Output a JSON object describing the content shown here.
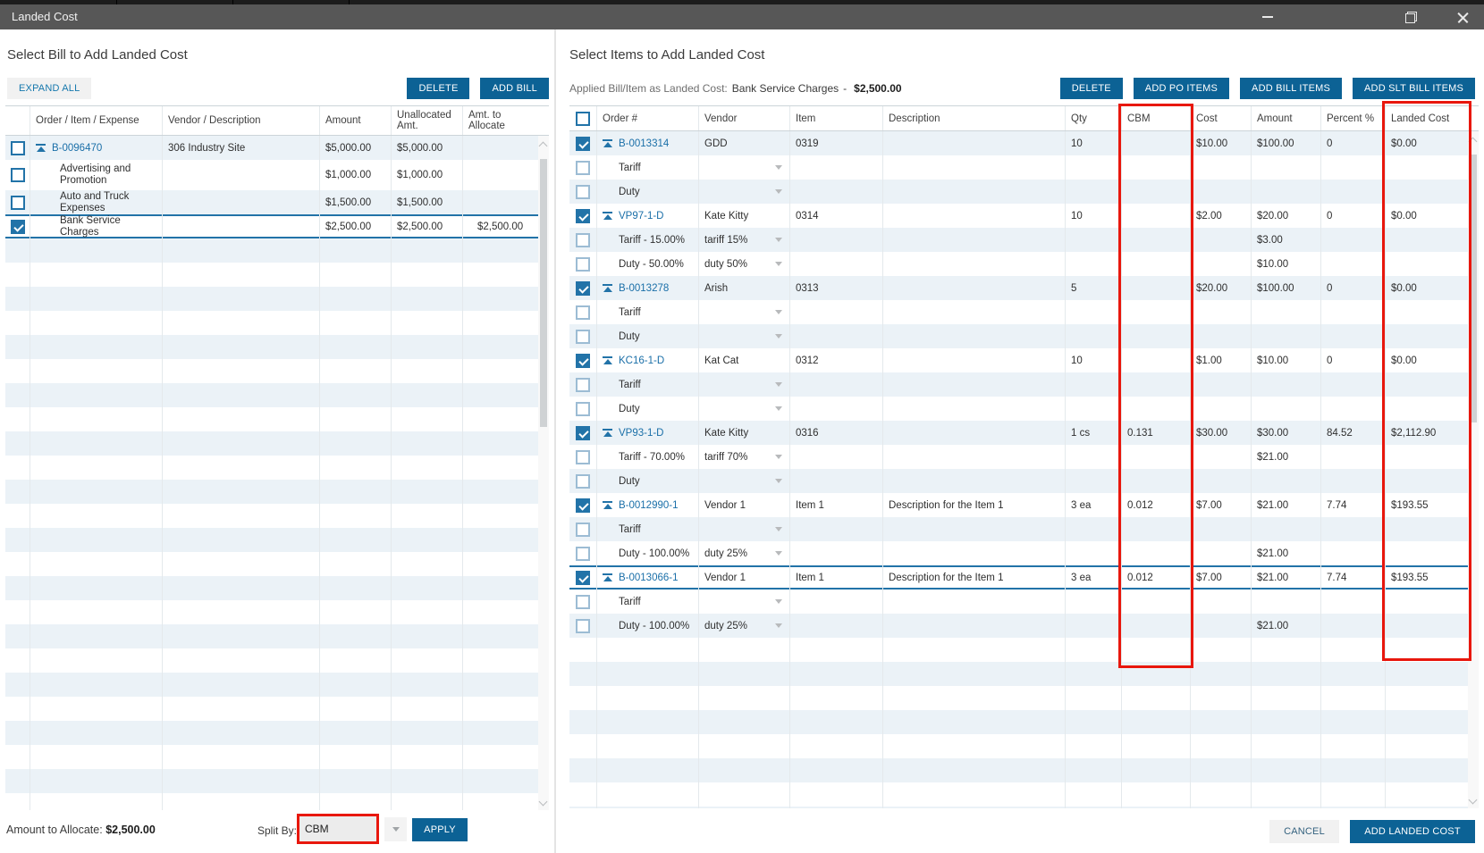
{
  "window": {
    "title": "Landed Cost"
  },
  "annotation_color": "#e8170d",
  "icons": {
    "collapse_icon": "bar-over-up-triangle",
    "dropdown_icon": "down-triangle",
    "checkbox_checked": "white-check-on-blue",
    "minimize_icon": "dash",
    "restore_icon": "overlapping-squares",
    "close_icon": "x"
  },
  "left_panel": {
    "heading": "Select Bill to Add Landed Cost",
    "expand_all_label": "EXPAND ALL",
    "delete_label": "DELETE",
    "add_bill_label": "ADD BILL",
    "table": {
      "columns": [
        "",
        "Order / Item / Expense",
        "Vendor / Description",
        "Amount",
        "Unallocated Amt.",
        "Amt. to Allocate"
      ],
      "rows": [
        {
          "checked": false,
          "link": "B-0096470",
          "vendor": "306 Industry Site",
          "amount": "$5,000.00",
          "unallocated": "$5,000.00",
          "allocate": "",
          "shade": true
        },
        {
          "checked": false,
          "label": "Advertising and Promotion",
          "vendor": "",
          "amount": "$1,000.00",
          "unallocated": "$1,000.00",
          "allocate": "",
          "shade": false,
          "tall": true
        },
        {
          "checked": false,
          "label": "Auto and Truck Expenses",
          "vendor": "",
          "amount": "$1,500.00",
          "unallocated": "$1,500.00",
          "allocate": "",
          "shade": true
        },
        {
          "checked": true,
          "label": "Bank Service Charges",
          "vendor": "",
          "amount": "$2,500.00",
          "unallocated": "$2,500.00",
          "allocate": "$2,500.00",
          "shade": false,
          "selected": true
        }
      ],
      "empty_rows": 24
    },
    "footer": {
      "amount_to_allocate_label": "Amount to Allocate:",
      "amount_to_allocate_value": "$2,500.00",
      "split_by_label": "Split By:",
      "split_by_value": "CBM",
      "apply_label": "APPLY"
    }
  },
  "right_panel": {
    "heading": "Select Items to Add Landed Cost",
    "applied_label": "Applied Bill/Item as Landed Cost:",
    "applied_bill": "Bank Service Charges",
    "applied_separator": "-",
    "applied_amount": "$2,500.00",
    "delete_label": "DELETE",
    "add_po_items_label": "ADD PO ITEMS",
    "add_bill_items_label": "ADD BILL ITEMS",
    "add_slt_bill_items_label": "ADD SLT BILL ITEMS",
    "table": {
      "columns": [
        "",
        "Order #",
        "Vendor",
        "Item",
        "Description",
        "Qty",
        "CBM",
        "Cost",
        "Amount",
        "Percent %",
        "Landed Cost"
      ],
      "rows": [
        {
          "type": "parent",
          "checked": true,
          "order": "B-0013314",
          "vendor": "GDD",
          "item": "0319",
          "description": "",
          "qty": "10",
          "cbm": "",
          "cost": "$10.00",
          "amount": "$100.00",
          "percent": "0",
          "landed": "$0.00",
          "shade": true
        },
        {
          "type": "sub",
          "label": "Tariff",
          "dropdown": "",
          "amount": "",
          "shade": false
        },
        {
          "type": "sub",
          "label": "Duty",
          "dropdown": "",
          "amount": "",
          "shade": true
        },
        {
          "type": "parent",
          "checked": true,
          "order": "VP97-1-D",
          "vendor": "Kate Kitty",
          "item": "0314",
          "description": "",
          "qty": "10",
          "cbm": "",
          "cost": "$2.00",
          "amount": "$20.00",
          "percent": "0",
          "landed": "$0.00",
          "shade": false
        },
        {
          "type": "sub",
          "label": "Tariff - 15.00%",
          "dropdown": "tariff 15%",
          "amount": "$3.00",
          "shade": true
        },
        {
          "type": "sub",
          "label": "Duty - 50.00%",
          "dropdown": "duty 50%",
          "amount": "$10.00",
          "shade": false
        },
        {
          "type": "parent",
          "checked": true,
          "order": "B-0013278",
          "vendor": "Arish",
          "item": "0313",
          "description": "",
          "qty": "5",
          "cbm": "",
          "cost": "$20.00",
          "amount": "$100.00",
          "percent": "0",
          "landed": "$0.00",
          "shade": true
        },
        {
          "type": "sub",
          "label": "Tariff",
          "dropdown": "",
          "amount": "",
          "shade": false
        },
        {
          "type": "sub",
          "label": "Duty",
          "dropdown": "",
          "amount": "",
          "shade": true
        },
        {
          "type": "parent",
          "checked": true,
          "order": "KC16-1-D",
          "vendor": "Kat Cat",
          "item": "0312",
          "description": "",
          "qty": "10",
          "cbm": "",
          "cost": "$1.00",
          "amount": "$10.00",
          "percent": "0",
          "landed": "$0.00",
          "shade": false
        },
        {
          "type": "sub",
          "label": "Tariff",
          "dropdown": "",
          "amount": "",
          "shade": true
        },
        {
          "type": "sub",
          "label": "Duty",
          "dropdown": "",
          "amount": "",
          "shade": false
        },
        {
          "type": "parent",
          "checked": true,
          "order": "VP93-1-D",
          "vendor": "Kate Kitty",
          "item": "0316",
          "description": "",
          "qty": "1 cs",
          "cbm": "0.131",
          "cost": "$30.00",
          "amount": "$30.00",
          "percent": "84.52",
          "landed": "$2,112.90",
          "shade": true
        },
        {
          "type": "sub",
          "label": "Tariff - 70.00%",
          "dropdown": "tariff 70%",
          "amount": "$21.00",
          "shade": false
        },
        {
          "type": "sub",
          "label": "Duty",
          "dropdown": "",
          "amount": "",
          "shade": true
        },
        {
          "type": "parent",
          "checked": true,
          "order": "B-0012990-1",
          "vendor": "Vendor 1",
          "item": "Item 1",
          "description": "Description for the Item 1",
          "qty": "3 ea",
          "cbm": "0.012",
          "cost": "$7.00",
          "amount": "$21.00",
          "percent": "7.74",
          "landed": "$193.55",
          "shade": false
        },
        {
          "type": "sub",
          "label": "Tariff",
          "dropdown": "",
          "amount": "",
          "shade": true
        },
        {
          "type": "sub",
          "label": "Duty - 100.00%",
          "dropdown": "duty 25%",
          "amount": "$21.00",
          "shade": false
        },
        {
          "type": "parent",
          "checked": true,
          "order": "B-0013066-1",
          "vendor": "Vendor 1",
          "item": "Item 1",
          "description": "Description for the Item 1",
          "qty": "3 ea",
          "cbm": "0.012",
          "cost": "$7.00",
          "amount": "$21.00",
          "percent": "7.74",
          "landed": "$193.55",
          "shade": false,
          "selected": true
        },
        {
          "type": "sub",
          "label": "Tariff",
          "dropdown": "",
          "amount": "",
          "shade": false
        },
        {
          "type": "sub",
          "label": "Duty - 100.00%",
          "dropdown": "duty 25%",
          "amount": "$21.00",
          "shade": true
        }
      ],
      "empty_rows": 8
    },
    "footer": {
      "cancel_label": "CANCEL",
      "add_landed_cost_label": "ADD LANDED COST"
    }
  }
}
